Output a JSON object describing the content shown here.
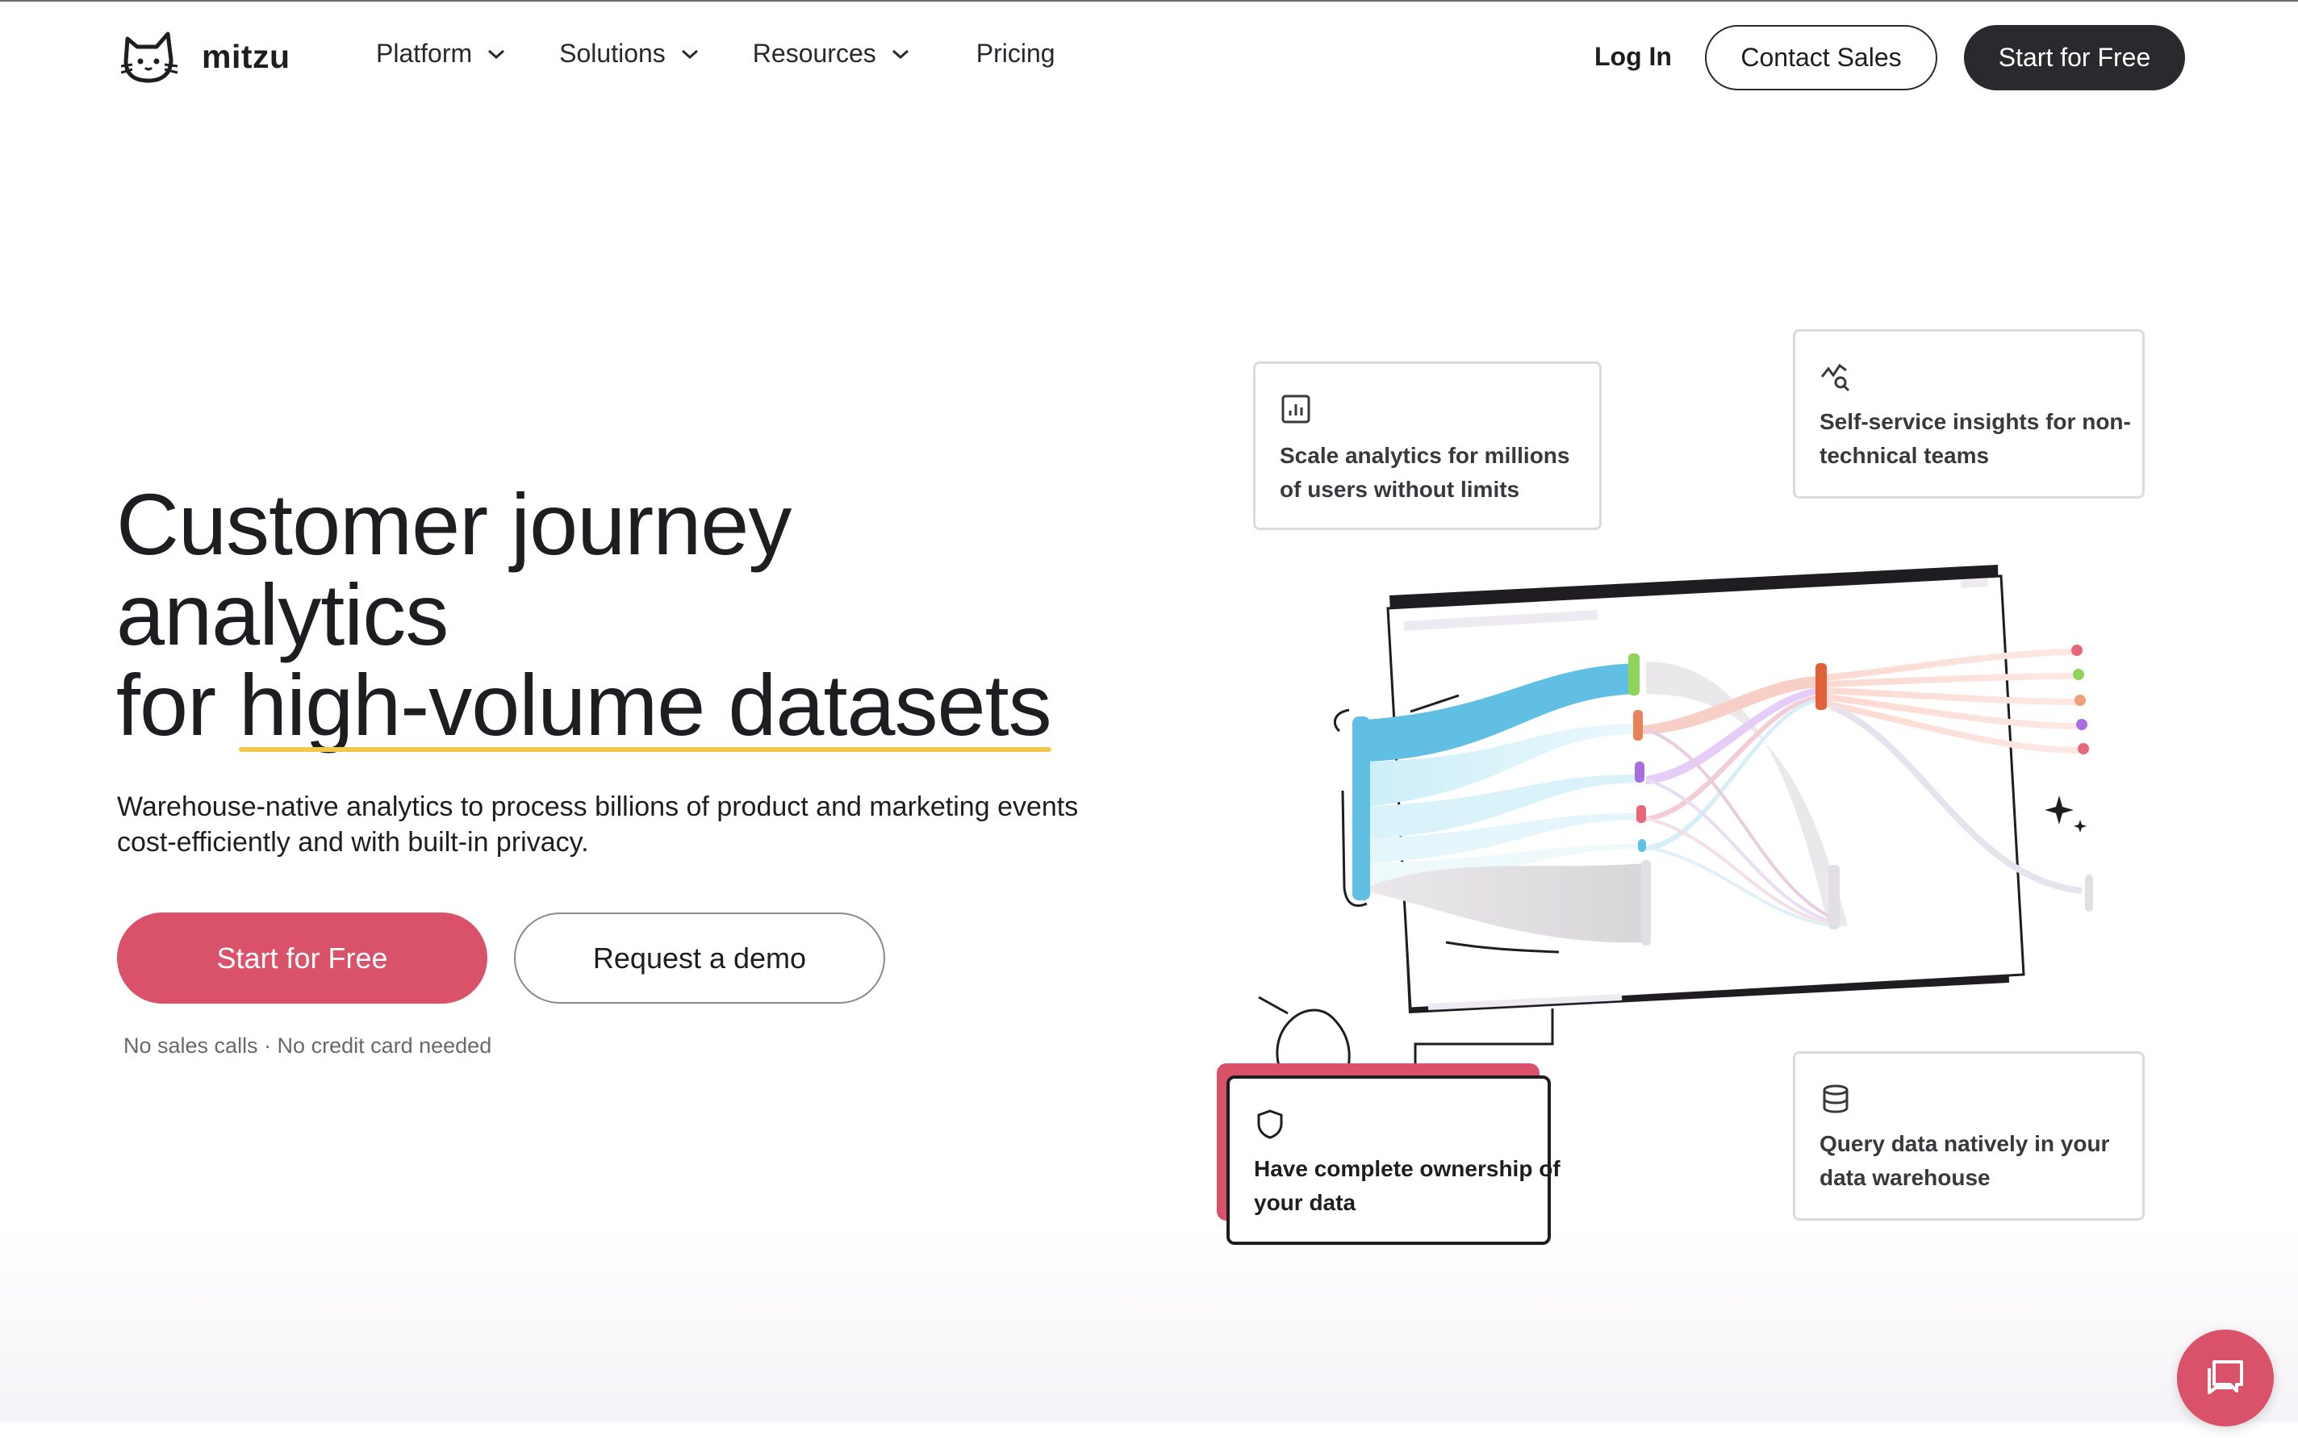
{
  "brand": {
    "name": "mitzu",
    "logo_icon": "cat-logo-icon"
  },
  "nav": {
    "items": [
      {
        "label": "Platform",
        "has_dropdown": true
      },
      {
        "label": "Solutions",
        "has_dropdown": true
      },
      {
        "label": "Resources",
        "has_dropdown": true
      },
      {
        "label": "Pricing",
        "has_dropdown": false
      }
    ],
    "login_label": "Log In",
    "contact_label": "Contact Sales",
    "start_label": "Start for Free"
  },
  "hero": {
    "title_line1": "Customer journey",
    "title_line2": "analytics",
    "title_line3_prefix": "for ",
    "title_line3_highlight": "high-volume datasets",
    "subtitle": "Warehouse-native analytics to process billions of product and marketing events cost-efficiently and with built-in privacy.",
    "primary_cta": "Start for Free",
    "secondary_cta": "Request a demo",
    "note": "No sales calls · No credit card needed"
  },
  "features": {
    "scale": {
      "text": "Scale analytics for millions of users without limits",
      "icon": "bar-chart-icon"
    },
    "self_service": {
      "text": "Self-service insights for non-technical teams",
      "icon": "chart-search-icon"
    },
    "ownership": {
      "text": "Have complete ownership of your data",
      "icon": "shield-icon"
    },
    "query": {
      "text": "Query data natively in your data warehouse",
      "icon": "database-icon"
    }
  },
  "colors": {
    "accent": "#d9526a",
    "dark": "#2b282e",
    "highlight": "#f2c94c",
    "flow_blue": "#5ab9e0",
    "flow_green": "#8fd45a",
    "flow_orange": "#e8825a",
    "flow_purple": "#a86ee0"
  },
  "chat": {
    "icon": "chat-bubble-icon"
  }
}
